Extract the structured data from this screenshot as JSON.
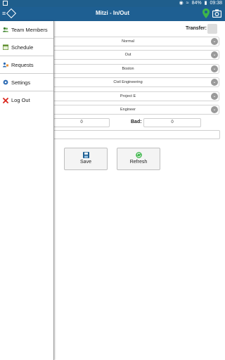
{
  "status_bar": {
    "battery": "84%",
    "time": "09:38"
  },
  "app_bar": {
    "title": "Mitzi - In/Out"
  },
  "form": {
    "transfer_label": "Transfer:",
    "selects": [
      {
        "value": "Normal"
      },
      {
        "value": "Out"
      },
      {
        "value": "Boston"
      },
      {
        "value": "Civil Engineering"
      },
      {
        "value": "Project E"
      },
      {
        "value": "Engineer"
      }
    ],
    "good_value": "0",
    "bad_label": "Bad:",
    "bad_value": "0",
    "save_label": "Save",
    "refresh_label": "Refresh"
  },
  "drawer": {
    "items": [
      {
        "label": "Team Members",
        "icon": "team-members-icon"
      },
      {
        "label": "Schedule",
        "icon": "schedule-icon"
      },
      {
        "label": "Requests",
        "icon": "requests-icon"
      },
      {
        "label": "Settings",
        "icon": "settings-icon"
      },
      {
        "label": "Log Out",
        "icon": "logout-icon"
      }
    ]
  },
  "colors": {
    "app_bar": "#1e5f92",
    "status_bar": "#1f5e8c",
    "pin": "#3db64a"
  }
}
